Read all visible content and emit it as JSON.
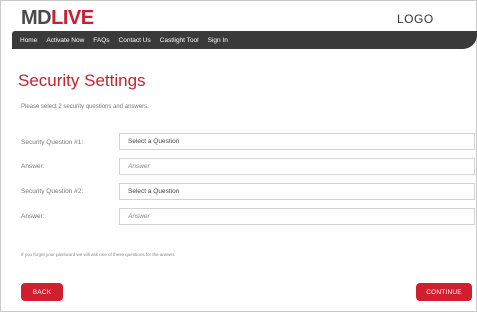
{
  "header": {
    "brand_part1": "MD",
    "brand_part2": "LIVE",
    "logo_text": "LOGO"
  },
  "nav": {
    "items": [
      "Home",
      "Activate Now",
      "FAQs",
      "Contact Us",
      "Castlight Tool",
      "Sign In"
    ]
  },
  "page": {
    "title": "Security Settings",
    "intro": "Please select 2 security questions and answers."
  },
  "form": {
    "q1_label": "Security Question #1:",
    "q1_value": "Select a Question",
    "a1_label": "Answer:",
    "a1_placeholder": "Answer",
    "q2_label": "Security Question #2:",
    "q2_value": "Select a Question",
    "a2_label": "Answer:",
    "a2_placeholder": "Answer"
  },
  "footnote": "If you forget your password we will ask one of these questions for the answer.",
  "buttons": {
    "back": "BACK",
    "continue": "CONTINUE"
  },
  "colors": {
    "accent": "#c8202f",
    "nav_bg": "#3a3a3a"
  }
}
